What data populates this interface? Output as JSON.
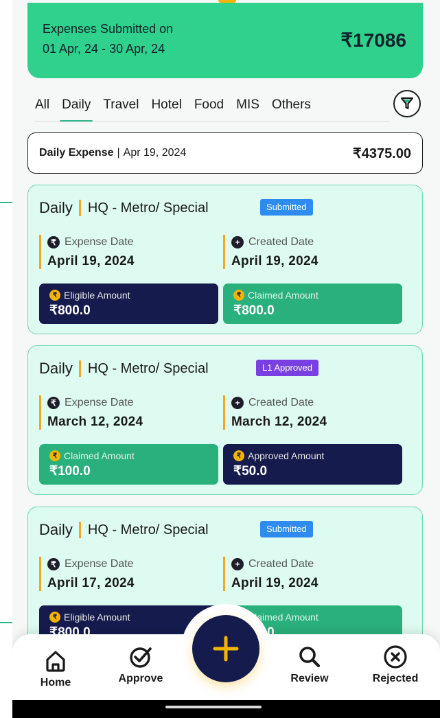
{
  "summary": {
    "line1": "Expenses Submitted on",
    "line2": "01 Apr, 24 - 30 Apr, 24",
    "total": "₹17086"
  },
  "tabs": [
    {
      "label": "All"
    },
    {
      "label": "Daily",
      "active": true
    },
    {
      "label": "Travel"
    },
    {
      "label": "Hotel"
    },
    {
      "label": "Food"
    },
    {
      "label": "MIS"
    },
    {
      "label": "Others"
    }
  ],
  "day_header": {
    "title": "Daily Expense",
    "separator": "|",
    "date": "Apr 19, 2024",
    "amount": "₹4375.00"
  },
  "cards": [
    {
      "kind": "Daily",
      "category": "HQ - Metro/ Special",
      "status": "Submitted",
      "expense_date_label": "Expense Date",
      "expense_date": "April 19, 2024",
      "created_date_label": "Created Date",
      "created_date": "April 19, 2024",
      "left_amount_label": "Eligible Amount",
      "left_amount": "₹800.0",
      "right_amount_label": "Claimed Amount",
      "right_amount": "₹800.0"
    },
    {
      "kind": "Daily",
      "category": "HQ - Metro/ Special",
      "status": "L1 Approved",
      "expense_date_label": "Expense Date",
      "expense_date": "March 12, 2024",
      "created_date_label": "Created Date",
      "created_date": "March 12, 2024",
      "left_amount_label": "Claimed Amount",
      "left_amount": "₹100.0",
      "right_amount_label": "Approved Amount",
      "right_amount": "₹50.0"
    },
    {
      "kind": "Daily",
      "category": "HQ - Metro/ Special",
      "status": "Submitted",
      "expense_date_label": "Expense Date",
      "expense_date": "April 17, 2024",
      "created_date_label": "Created Date",
      "created_date": "April 19, 2024",
      "left_amount_label": "Eligible Amount",
      "left_amount": "₹800.0",
      "right_amount_label": "Claimed Amount",
      "right_amount": "₹800.0"
    }
  ],
  "nav": {
    "home": "Home",
    "approve": "Approve",
    "review": "Review",
    "rejected": "Rejected"
  },
  "colors": {
    "accent_green": "#2fd18c",
    "navy": "#151b4d",
    "orange": "#f5a623",
    "submitted_badge": "#2e8cf0",
    "approved_badge": "#7a3fe0"
  }
}
